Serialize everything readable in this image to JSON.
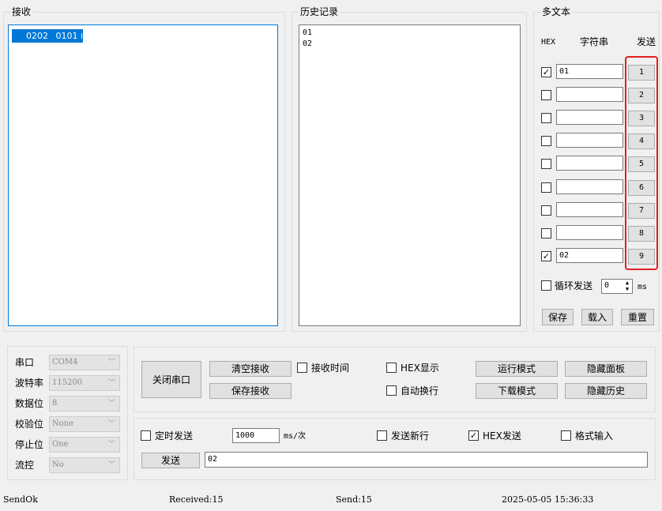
{
  "receive": {
    "title": "接收",
    "content": "0202 0101",
    "trailing_glyph": "lm"
  },
  "history": {
    "title": "历史记录",
    "lines": [
      "01",
      "02"
    ]
  },
  "multi_text": {
    "title": "多文本",
    "col_hex": "HEX",
    "col_string": "字符串",
    "col_send": "发送",
    "rows": [
      {
        "checked": true,
        "value": "01",
        "button": "1"
      },
      {
        "checked": false,
        "value": "",
        "button": "2"
      },
      {
        "checked": false,
        "value": "",
        "button": "3"
      },
      {
        "checked": false,
        "value": "",
        "button": "4"
      },
      {
        "checked": false,
        "value": "",
        "button": "5"
      },
      {
        "checked": false,
        "value": "",
        "button": "6"
      },
      {
        "checked": false,
        "value": "",
        "button": "7"
      },
      {
        "checked": false,
        "value": "",
        "button": "8"
      },
      {
        "checked": true,
        "value": "02",
        "button": "9"
      }
    ],
    "loop_label": "循环发送",
    "loop_value": "0",
    "loop_unit": "ms",
    "save": "保存",
    "load": "载入",
    "reset": "重置",
    "highlight_color": "#e02020"
  },
  "serial": {
    "port_label": "串口",
    "port_value": "COM4",
    "baud_label": "波特率",
    "baud_value": "115200",
    "databits_label": "数据位",
    "databits_value": "8",
    "parity_label": "校验位",
    "parity_value": "None",
    "stopbits_label": "停止位",
    "stopbits_value": "One",
    "flow_label": "流控",
    "flow_value": "No"
  },
  "controls": {
    "close_port": "关闭串口",
    "clear_receive": "清空接收",
    "save_receive": "保存接收",
    "receive_time": "接收时间",
    "hex_display": "HEX显示",
    "auto_wrap": "自动换行",
    "run_mode": "运行模式",
    "download_mode": "下载模式",
    "hide_panel": "隐藏面板",
    "hide_history": "隐藏历史"
  },
  "send": {
    "timed_send": "定时发送",
    "interval": "1000",
    "interval_unit": "ms/次",
    "send_newline": "发送新行",
    "hex_send": "HEX发送",
    "hex_send_checked": true,
    "format_input": "格式输入",
    "send_button": "发送",
    "send_text": "02"
  },
  "statusbar": {
    "state": "SendOk",
    "received": "Received:15",
    "sent": "Send:15",
    "datetime": "2025-05-05 15:36:33"
  },
  "selection_color": "#0078d7"
}
